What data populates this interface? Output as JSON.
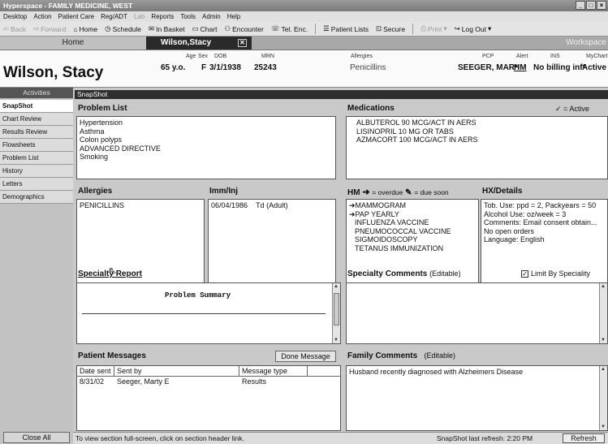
{
  "window": {
    "title": "Hyperspace - FAMILY MEDICINE, WEST",
    "controls": [
      "_",
      "□",
      "×"
    ]
  },
  "menu": [
    "Desktop",
    "Action",
    "Patient Care",
    "Reg/ADT",
    "Lab",
    "Reports",
    "Tools",
    "Admin",
    "Help"
  ],
  "toolbar": {
    "back": "Back",
    "forward": "Forward",
    "home": "Home",
    "schedule": "Schedule",
    "inbasket": "In Basket",
    "chart": "Chart",
    "encounter": "Encounter",
    "telenc": "Tel. Enc.",
    "patientlists": "Patient Lists",
    "secure": "Secure",
    "print": "Print",
    "logout": "Log Out"
  },
  "tabs": {
    "home": "Home",
    "patient": "Wilson,Stacy",
    "workspace": "Workspace"
  },
  "patient": {
    "name": "Wilson, Stacy",
    "age_label": "Age",
    "age": "65 y.o.",
    "sex_label": "Sex",
    "sex": "F",
    "dob_label": "DOB",
    "dob": "3/1/1938",
    "mrn_label": "MRN",
    "mrn": "25243",
    "allergies_label": "Allergies",
    "allergies": "Penicillins",
    "pcp_label": "PCP",
    "pcp": "SEEGER, MAR*",
    "alert_label": "Alert",
    "alert": "HM",
    "ins_label": "INS",
    "ins": "No billing inf*",
    "mychart_label": "MyChart",
    "mychart": "Active"
  },
  "sidebar": {
    "activities": "Activities",
    "items": [
      "SnapShot",
      "Chart Review",
      "Results Review",
      "Flowsheets",
      "Problem List",
      "History",
      "Letters",
      "Demographics"
    ],
    "close_all": "Close All"
  },
  "snapshot": {
    "title": "SnapShot",
    "problem_list": {
      "header": "Problem List",
      "items": [
        "Hypertension",
        "Asthma",
        "Colon polyps",
        "ADVANCED DIRECTIVE",
        "Smoking"
      ]
    },
    "medications": {
      "header": "Medications",
      "legend": "= Active",
      "items": [
        "ALBUTEROL 90 MCG/ACT IN AERS",
        "LISINOPRIL 10 MG OR TABS",
        "AZMACORT 100 MCG/ACT IN AERS"
      ]
    },
    "allergies": {
      "header": "Allergies",
      "items": [
        "PENICILLINS"
      ]
    },
    "imm": {
      "header": "Imm/Inj",
      "date": "06/04/1986",
      "name": "Td (Adult)"
    },
    "hm": {
      "header": "HM",
      "overdue": "= overdue",
      "duesoon": "= due soon",
      "items": [
        "MAMMOGRAM",
        "PAP YEARLY",
        "INFLUENZA VACCINE",
        "PNEUMOCOCCAL VACCINE",
        "SIGMOIDOSCOPY",
        "TETANUS IMMUNIZATION"
      ]
    },
    "hx": {
      "header": "HX/Details",
      "items": [
        "Tob. Use: ppd = 2, Packyears = 50",
        "Alcohol Use: oz/week = 3",
        "Comments: Email consent obtain...",
        "No open orders",
        "Language: English"
      ]
    },
    "specialty_report": {
      "header": "Specialty Report",
      "content": "Problem Summary"
    },
    "specialty_comments": {
      "header": "Specialty Comments",
      "editable": "(Editable)",
      "limit": "Limit By Speciality"
    },
    "messages": {
      "header": "Patient Messages",
      "done_button": "Done Message",
      "columns": [
        "Date sent",
        "Sent by",
        "Message type"
      ],
      "rows": [
        {
          "date": "8/31/02",
          "sender": "Seeger, Marty E",
          "type": "Results"
        }
      ]
    },
    "family_comments": {
      "header": "Family Comments",
      "editable": "(Editable)",
      "text": "Husband recently diagnosed with Alzheimers Disease"
    }
  },
  "status": {
    "hint": "To view section full-screen, click on section header link.",
    "refresh_time": "SnapShot last refresh: 2:20 PM",
    "refresh_button": "Refresh"
  }
}
